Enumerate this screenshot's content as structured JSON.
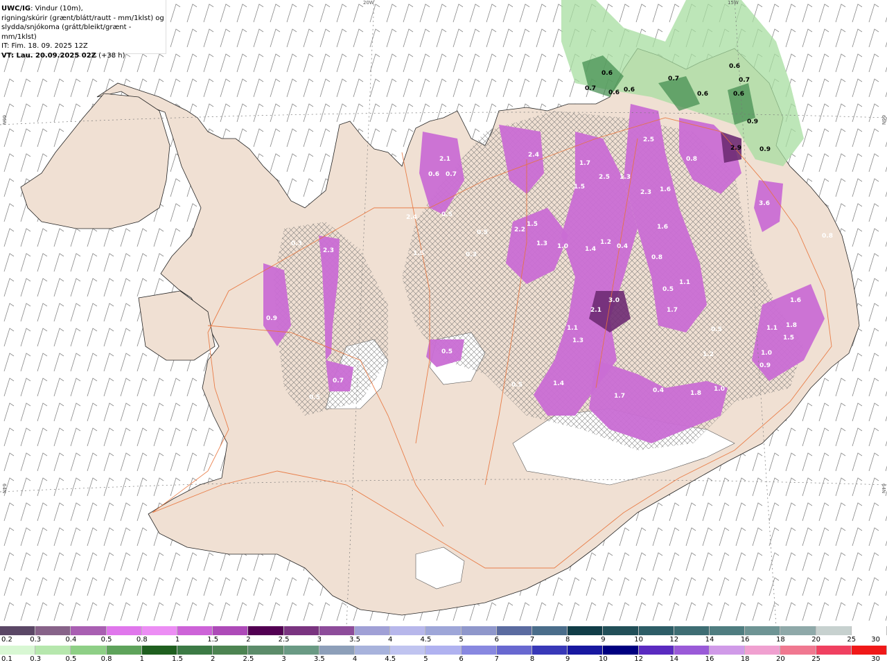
{
  "header": {
    "model": "UWC/IG",
    "line1_rest": ": Vindur (10m),",
    "line2": "rigning/skúrir (grænt/blátt/rautt - mm/1klst) og",
    "line3": "slydda/snjókoma (grátt/bleikt/grænt - mm/1klst)",
    "line4": "IT: Fim. 18. 09. 2025 12Z",
    "line5_bold": "VT: Lau. 20.09.2025 02Z",
    "line5_rest": " (+38 h)"
  },
  "edge_labels": {
    "top_left": "20W",
    "top_right": "15W",
    "left_top": "66N",
    "left_bottom": "64N",
    "right_top": "66N",
    "right_bottom": "64N"
  },
  "map_values": [
    {
      "t": "0.6"
    },
    {
      "t": "0.7"
    },
    {
      "t": "0.6"
    },
    {
      "t": "0.6"
    },
    {
      "t": "0.6"
    },
    {
      "t": "0.7"
    },
    {
      "t": "0.6"
    },
    {
      "t": "0.7"
    },
    {
      "t": "0.6"
    },
    {
      "t": "0.9"
    },
    {
      "t": "2.9"
    },
    {
      "t": "0.9"
    },
    {
      "t": "2.5"
    },
    {
      "t": "2.5"
    },
    {
      "t": "1.3"
    },
    {
      "t": "2.3"
    },
    {
      "t": "1.6"
    },
    {
      "t": "1.7"
    },
    {
      "t": "1.5"
    },
    {
      "t": "0.8"
    },
    {
      "t": "3.6"
    },
    {
      "t": "2.4"
    },
    {
      "t": "2.1"
    },
    {
      "t": "0.7"
    },
    {
      "t": "0.5"
    },
    {
      "t": "1.5"
    },
    {
      "t": "2.2"
    },
    {
      "t": "1.3"
    },
    {
      "t": "1.0"
    },
    {
      "t": "1.4"
    },
    {
      "t": "1.2"
    },
    {
      "t": "0.4"
    },
    {
      "t": "1.6"
    },
    {
      "t": "0.8"
    },
    {
      "t": "0.5"
    },
    {
      "t": "1.1"
    },
    {
      "t": "2.1"
    },
    {
      "t": "3.0"
    },
    {
      "t": "1.7"
    },
    {
      "t": "1.1"
    },
    {
      "t": "1.3"
    },
    {
      "t": "1.4"
    },
    {
      "t": "1.7"
    },
    {
      "t": "0.4"
    },
    {
      "t": "1.8"
    },
    {
      "t": "1.0"
    },
    {
      "t": "1.2"
    },
    {
      "t": "0.5"
    },
    {
      "t": "1.6"
    },
    {
      "t": "1.1"
    },
    {
      "t": "1.8"
    },
    {
      "t": "1.5"
    },
    {
      "t": "1.0"
    },
    {
      "t": "0.9"
    },
    {
      "t": "0.9"
    },
    {
      "t": "2.3"
    },
    {
      "t": "0.3"
    },
    {
      "t": "0.7"
    },
    {
      "t": "0.5"
    },
    {
      "t": "0.5"
    },
    {
      "t": "1.5"
    },
    {
      "t": "2.4"
    },
    {
      "t": "0.5"
    },
    {
      "t": "0.3"
    },
    {
      "t": "0.5"
    },
    {
      "t": "0.8"
    },
    {
      "t": "0.6"
    }
  ],
  "legend_snow": {
    "colors": [
      "#5b4766",
      "#876389",
      "#a95fb2",
      "#e077ec",
      "#ec8df4",
      "#cd63d8",
      "#ad4ab8",
      "#520052",
      "#7a3480",
      "#8d4c9a",
      "#a0a0d6",
      "#b7b7eb",
      "#9ea6d8",
      "#8f97cb",
      "#5b6ba0",
      "#4a6d8a",
      "#113d47",
      "#224f58",
      "#2d5d66",
      "#3e6d73",
      "#4f7d80",
      "#6e9494",
      "#8fa9a9",
      "#c7d1cf",
      "#ffffff"
    ],
    "labels": [
      "0.2",
      "0.3",
      "0.4",
      "0.5",
      "0.8",
      "1",
      "1.5",
      "2",
      "2.5",
      "3",
      "3.5",
      "4",
      "4.5",
      "5",
      "6",
      "7",
      "8",
      "9",
      "10",
      "12",
      "14",
      "16",
      "18",
      "20",
      "25",
      "30"
    ]
  },
  "legend_rain": {
    "colors": [
      "#d8f7d3",
      "#b6e7ad",
      "#8ecf86",
      "#5ea35b",
      "#1f5f1f",
      "#3c7a45",
      "#4d8452",
      "#5c8c6a",
      "#6a9a84",
      "#8d9fb9",
      "#a8b3dc",
      "#c0c4f0",
      "#b0b2f0",
      "#8888e0",
      "#6868d0",
      "#3838b8",
      "#1818a0",
      "#000080",
      "#5a2ac0",
      "#9a5ad8",
      "#d09ae8",
      "#f0a0d0",
      "#f07890",
      "#f04060",
      "#f01818"
    ],
    "labels": [
      "0.1",
      "0.3",
      "0.5",
      "0.8",
      "1",
      "1.5",
      "2",
      "2.5",
      "3",
      "3.5",
      "4",
      "4.5",
      "5",
      "6",
      "7",
      "8",
      "9",
      "10",
      "12",
      "14",
      "16",
      "18",
      "20",
      "25",
      "30"
    ]
  }
}
